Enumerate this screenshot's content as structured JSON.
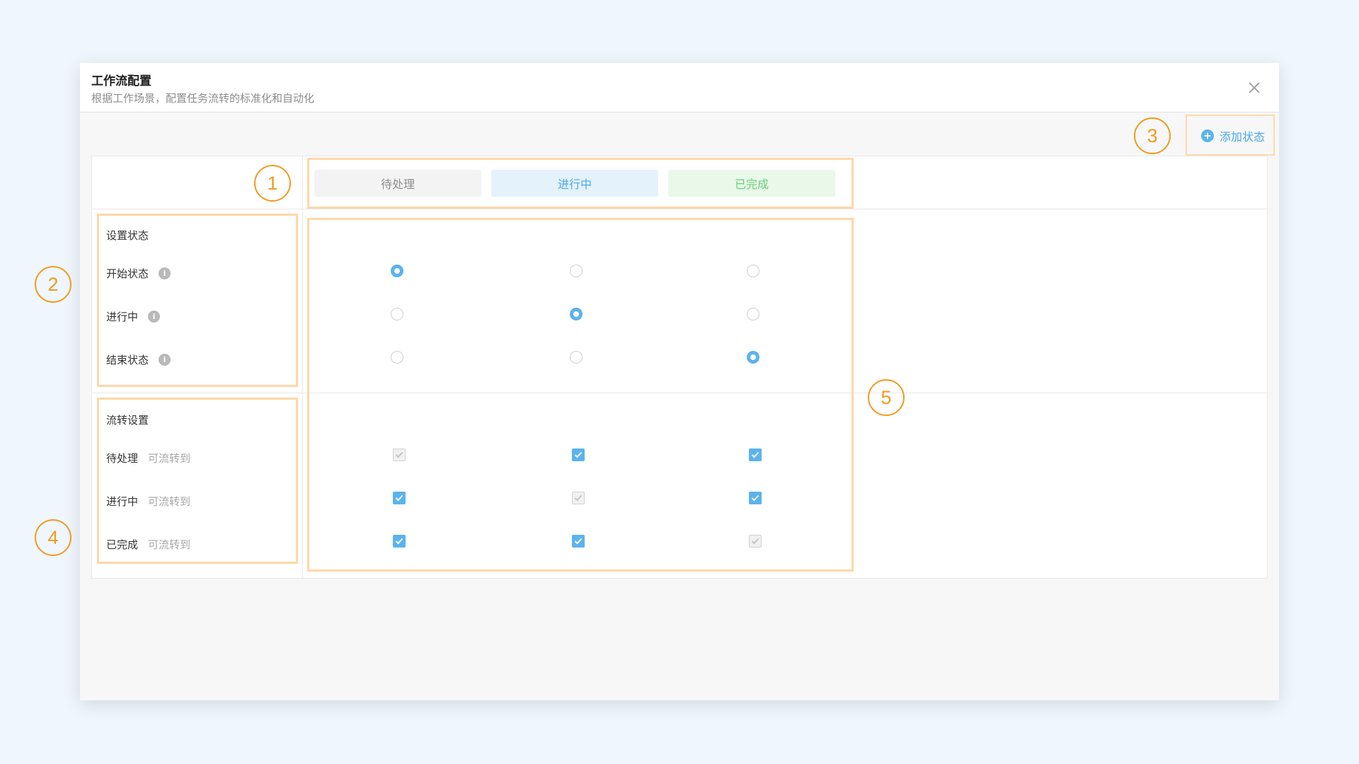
{
  "dialog": {
    "title": "工作流配置",
    "subtitle": "根据工作场景，配置任务流转的标准化和自动化",
    "close_icon": "close-icon"
  },
  "toolbar": {
    "add_label": "添加状态",
    "add_icon": "plus-circle-icon"
  },
  "statuses": [
    "待处理",
    "进行中",
    "已完成"
  ],
  "state_section": {
    "title": "设置状态",
    "rows": [
      {
        "label": "开始状态",
        "selected": 0
      },
      {
        "label": "进行中",
        "selected": 1
      },
      {
        "label": "结束状态",
        "selected": 2
      }
    ]
  },
  "flow_section": {
    "title": "流转设置",
    "suffix": "可流转到",
    "rows": [
      {
        "label": "待处理",
        "checks": [
          false,
          true,
          true
        ],
        "disabled": 0
      },
      {
        "label": "进行中",
        "checks": [
          true,
          false,
          true
        ],
        "disabled": 1
      },
      {
        "label": "已完成",
        "checks": [
          true,
          true,
          false
        ],
        "disabled": 2
      }
    ]
  },
  "annotations": [
    "1",
    "2",
    "3",
    "4",
    "5"
  ],
  "colors": {
    "accent": "#5bb3ee",
    "highlight": "#ffd7a8",
    "annotation": "#f39a1e"
  }
}
